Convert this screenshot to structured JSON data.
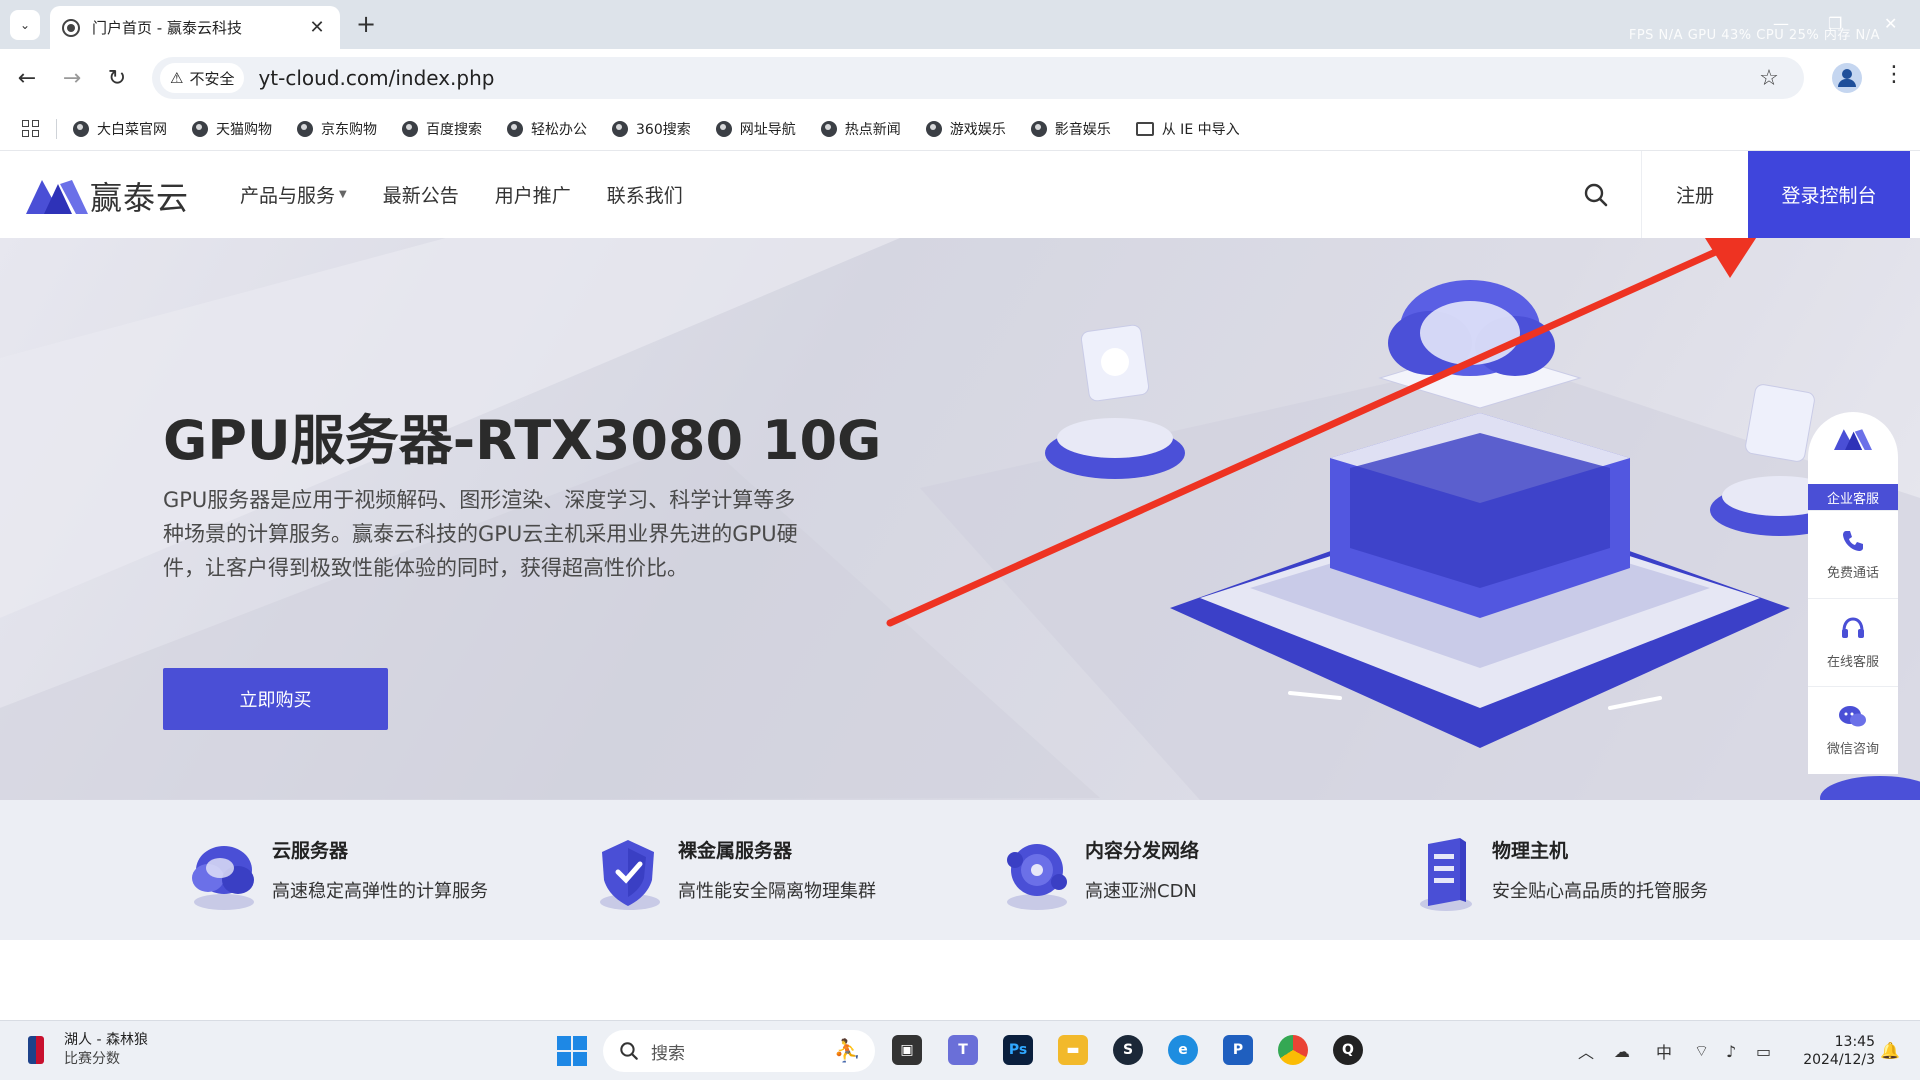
{
  "browser": {
    "tab": {
      "title": "门户首页 - 赢泰云科技"
    },
    "overlay_stats": "FPS N/A GPU 43% CPU 25% 内存 N/A",
    "security_label": "不安全",
    "url": "yt-cloud.com/index.php",
    "bookmarks": [
      "大白菜官网",
      "天猫购物",
      "京东购物",
      "百度搜索",
      "轻松办公",
      "360搜索",
      "网址导航",
      "热点新闻",
      "游戏娱乐",
      "影音娱乐"
    ],
    "bookmark_folder": "从 IE 中导入"
  },
  "site": {
    "logo_text": "赢泰云",
    "nav": [
      "产品与服务",
      "最新公告",
      "用户推广",
      "联系我们"
    ],
    "register": "注册",
    "login": "登录控制台",
    "brand_color": "#3f45dc"
  },
  "hero": {
    "title": "GPU服务器-RTX3080 10G",
    "description": "GPU服务器是应用于视频解码、图形渲染、深度学习、科学计算等多种场景的计算服务。赢泰云科技的GPU云主机采用业界先进的GPU硬件，让客户得到极致性能体验的同时，获得超高性价比。",
    "button": "立即购买"
  },
  "float_panel": {
    "top_label": "企业客服",
    "items": [
      {
        "label": "免费通话",
        "icon": "phone-icon"
      },
      {
        "label": "在线客服",
        "icon": "headset-icon"
      },
      {
        "label": "微信咨询",
        "icon": "chat-icon"
      }
    ]
  },
  "features": [
    {
      "title": "云服务器",
      "desc": "高速稳定高弹性的计算服务",
      "icon": "cloud-server-icon"
    },
    {
      "title": "裸金属服务器",
      "desc": "高性能安全隔离物理集群",
      "icon": "shield-server-icon"
    },
    {
      "title": "内容分发网络",
      "desc": "高速亚洲CDN",
      "icon": "cdn-icon"
    },
    {
      "title": "物理主机",
      "desc": "安全贴心高品质的托管服务",
      "icon": "physical-host-icon"
    }
  ],
  "taskbar": {
    "news_title": "湖人 - 森林狼",
    "news_sub": "比赛分数",
    "search_placeholder": "搜索",
    "ime": "中",
    "time": "13:45",
    "date": "2024/12/3"
  }
}
